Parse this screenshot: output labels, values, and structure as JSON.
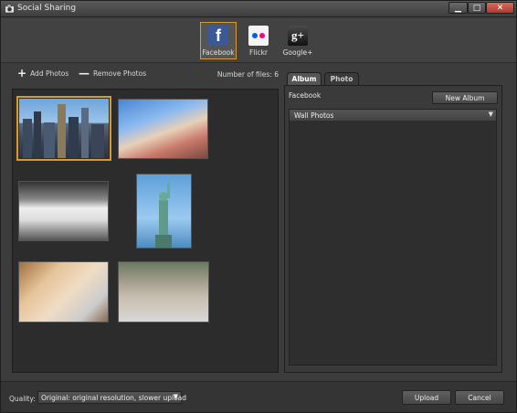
{
  "window": {
    "title": "Social Sharing"
  },
  "title_buttons": {
    "minimize": "▁",
    "maximize": "□",
    "close": "✕"
  },
  "services": [
    {
      "label": "Facebook",
      "icon": "facebook-icon",
      "glyph": "f",
      "active": true
    },
    {
      "label": "Flickr",
      "icon": "flickr-icon",
      "active": false
    },
    {
      "label": "Google+",
      "icon": "google-plus-icon",
      "glyph": "g+",
      "active": false
    }
  ],
  "toolbar": {
    "add_photos": "Add Photos",
    "add_icon": "+",
    "remove_photos": "Remove Photos",
    "remove_icon": "—",
    "file_count": "Number of files: 6"
  },
  "photos": [
    {
      "subject": "city skyline",
      "selected": true
    },
    {
      "subject": "friends at beach",
      "selected": false
    },
    {
      "subject": "cafe chairs",
      "selected": false
    },
    {
      "subject": "statue of liberty",
      "selected": false
    },
    {
      "subject": "family lunch",
      "selected": false
    },
    {
      "subject": "street with stroller",
      "selected": false
    }
  ],
  "tabs": {
    "album": "Album",
    "photo": "Photo"
  },
  "album_panel": {
    "service_label": "Facebook",
    "new_album": "New Album",
    "selected_album": "Wall Photos",
    "dropdown_arrow": "▼"
  },
  "bottom": {
    "quality_label": "Quality:",
    "quality_value": "Original: original resolution, slower upload",
    "quality_arrow": "▼",
    "upload": "Upload",
    "cancel": "Cancel"
  },
  "colors": {
    "accent": "#d89a2c",
    "facebook": "#3b5998",
    "flickr_blue": "#0063dc",
    "flickr_pink": "#ff0084"
  }
}
